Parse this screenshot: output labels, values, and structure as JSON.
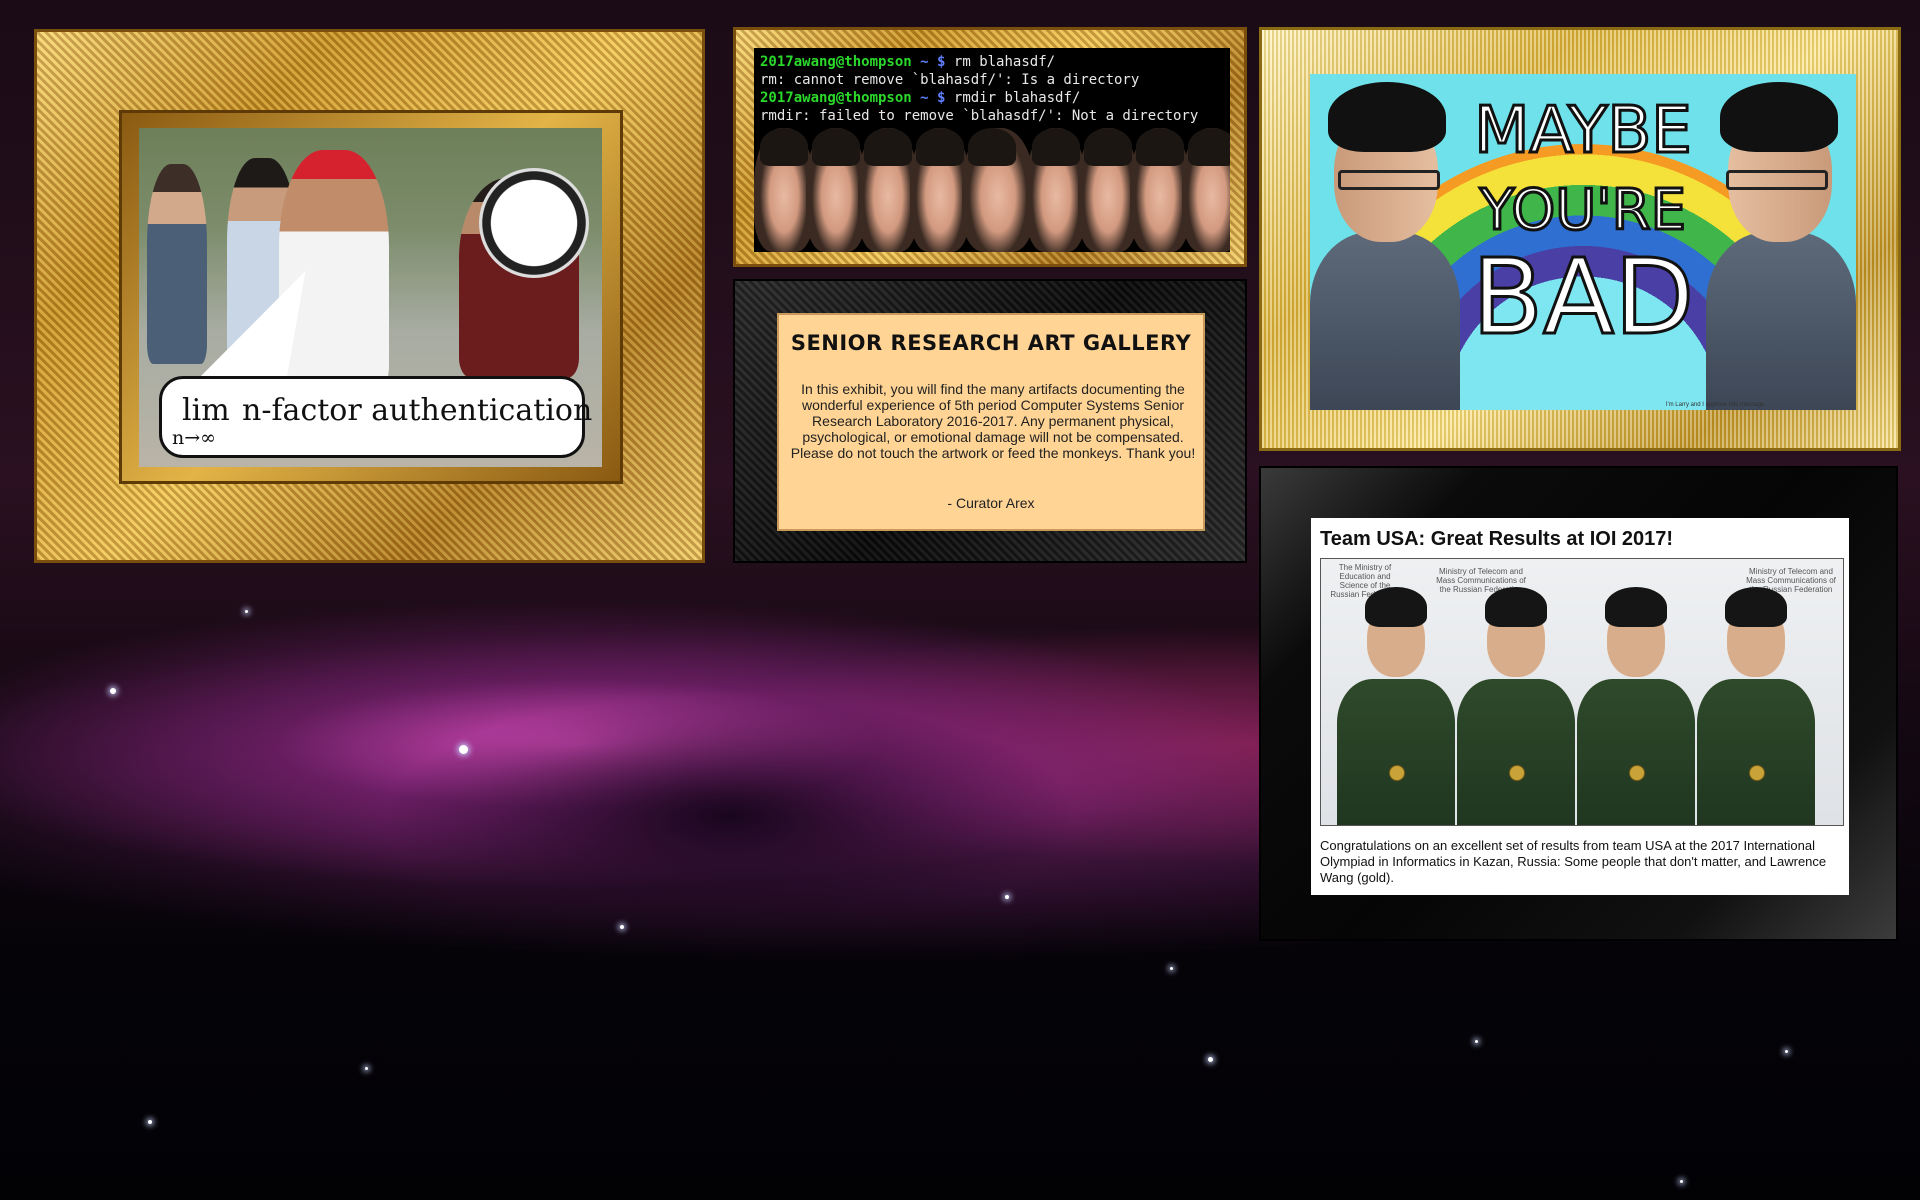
{
  "background": {
    "name": "horsehead-nebula",
    "accent_color": "#c03cb0"
  },
  "frame_nfactor": {
    "lim_word": "lim",
    "lim_subscript": "n→∞",
    "expression": "n-factor authentication"
  },
  "terminal": {
    "lines": [
      {
        "user": "2017awang@thompson",
        "path": "~",
        "prompt": "$",
        "command": "rm blahasdf/"
      },
      {
        "output": "rm: cannot remove `blahasdf/': Is a directory"
      },
      {
        "user": "2017awang@thompson",
        "path": "~",
        "prompt": "$",
        "command": "rmdir blahasdf/"
      },
      {
        "output": "rmdir: failed to remove `blahasdf/': Not a directory"
      }
    ]
  },
  "maybe": {
    "line1": "MAYBE",
    "line2": "YOU'RE",
    "line3": "BAD",
    "caption": "I'm Larry and I approve this message."
  },
  "gallery": {
    "title": "SENIOR RESEARCH ART GALLERY",
    "body": "In this exhibit, you will find the many artifacts documenting the wonderful experience of 5th period Computer Systems Senior Research Laboratory 2016-2017.  Any permanent physical, psychological, or emotional damage will not be compensated.  Please do not touch the artwork or feed the monkeys.  Thank you!",
    "signature": "- Curator Arex"
  },
  "news": {
    "title": "Team USA: Great Results at IOI 2017!",
    "banner_left": "The Ministry of Education and Science of the Russian Federation",
    "banner_mid": "Ministry of Telecom and Mass Communications of the Russian Federation",
    "banner_right": "Ministry of Telecom and Mass Communications of the Russian Federation",
    "caption": "Congratulations on an excellent set of results from team USA at the 2017 International Olympiad in Informatics in Kazan, Russia: Some people that don't matter, and Lawrence Wang (gold)."
  }
}
